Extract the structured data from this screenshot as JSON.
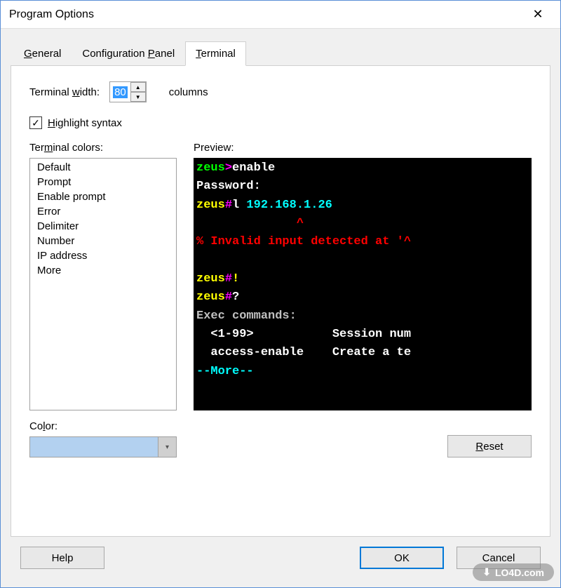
{
  "window": {
    "title": "Program Options"
  },
  "tabs": {
    "general": "General",
    "config": "Configuration Panel",
    "terminal": "Terminal"
  },
  "terminal": {
    "width_label": "Terminal width:",
    "width_value": "80",
    "columns_label": "columns",
    "highlight_label": "Highlight syntax",
    "highlight_checked": true,
    "colors_label": "Terminal colors:",
    "colors": [
      "Default",
      "Prompt",
      "Enable prompt",
      "Error",
      "Delimiter",
      "Number",
      "IP address",
      "More"
    ],
    "preview_label": "Preview:",
    "preview_lines": [
      [
        {
          "c": "green",
          "t": "zeus"
        },
        {
          "c": "purple",
          "t": ">"
        },
        {
          "c": "white",
          "t": "enable"
        }
      ],
      [
        {
          "c": "white",
          "t": "Password:"
        }
      ],
      [
        {
          "c": "yellow",
          "t": "zeus"
        },
        {
          "c": "purple",
          "t": "#"
        },
        {
          "c": "white",
          "t": "l "
        },
        {
          "c": "cyan",
          "t": "192.168.1.26"
        }
      ],
      [
        {
          "c": "red",
          "t": "              ^"
        }
      ],
      [
        {
          "c": "red",
          "t": "% Invalid input detected at '^"
        }
      ],
      [
        {
          "c": "white",
          "t": ""
        }
      ],
      [
        {
          "c": "yellow",
          "t": "zeus"
        },
        {
          "c": "purple",
          "t": "#"
        },
        {
          "c": "yellow",
          "t": "!"
        }
      ],
      [
        {
          "c": "yellow",
          "t": "zeus"
        },
        {
          "c": "purple",
          "t": "#"
        },
        {
          "c": "white",
          "t": "?"
        }
      ],
      [
        {
          "c": "gray",
          "t": "Exec commands:"
        }
      ],
      [
        {
          "c": "white",
          "t": "  <1-99>           Session num"
        }
      ],
      [
        {
          "c": "white",
          "t": "  access-enable    Create a te"
        }
      ],
      [
        {
          "c": "cyan",
          "t": "--More--"
        }
      ]
    ],
    "color_label": "Color:",
    "color_value": "",
    "reset_label": "Reset"
  },
  "buttons": {
    "help": "Help",
    "ok": "OK",
    "cancel": "Cancel"
  },
  "watermark": "LO4D.com"
}
